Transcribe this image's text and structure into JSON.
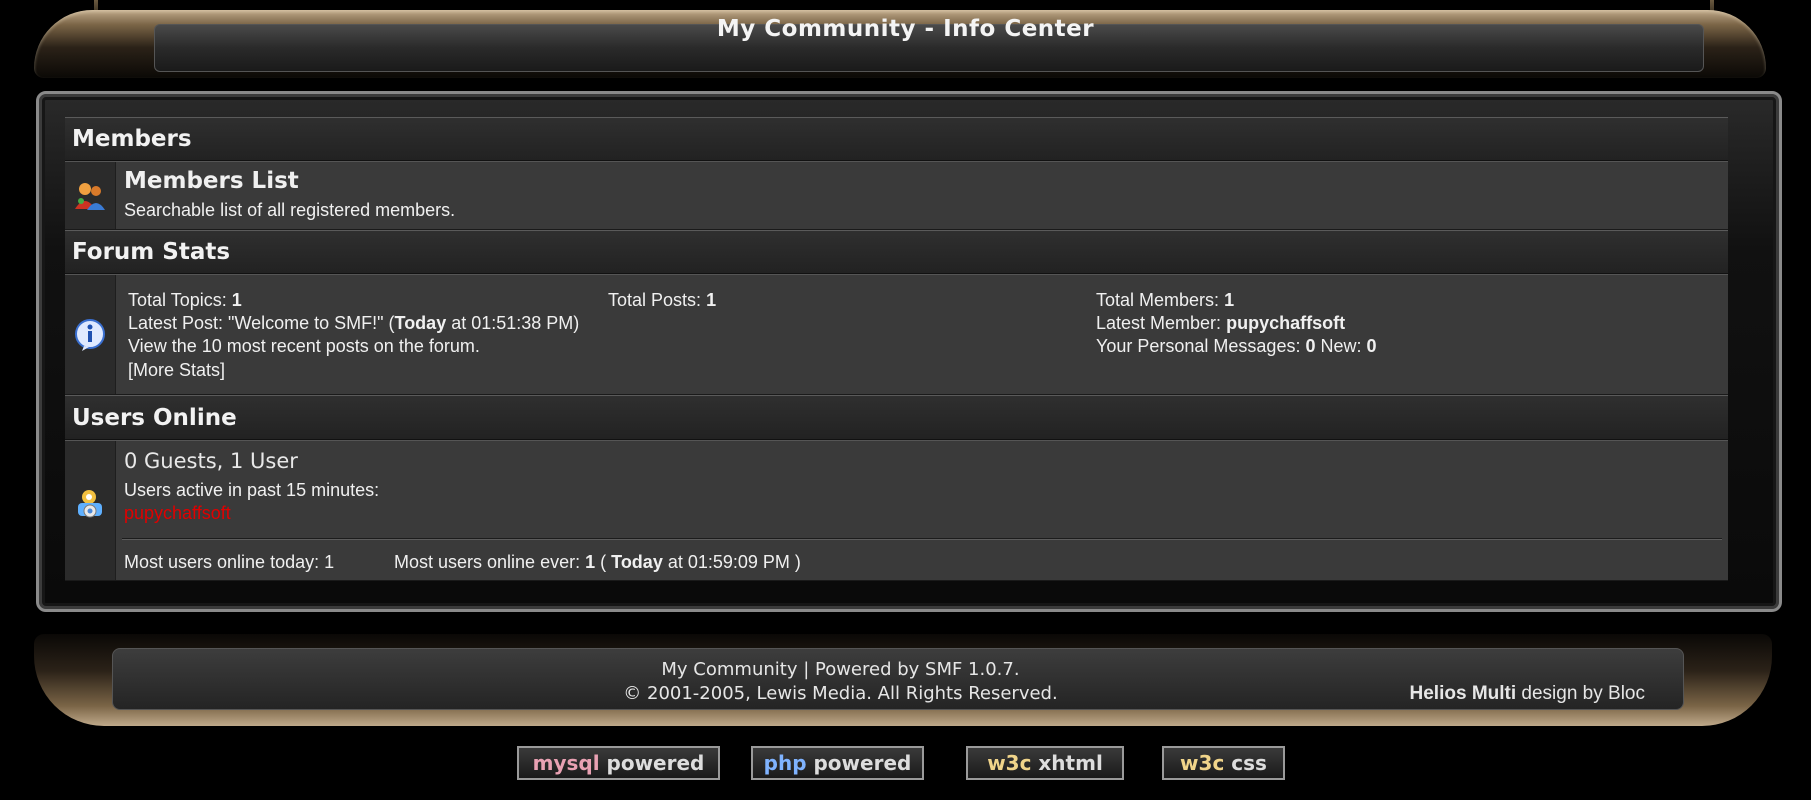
{
  "header": {
    "title": "My Community - Info Center"
  },
  "members": {
    "heading": "Members",
    "list_title": "Members List",
    "list_desc": "Searchable list of all registered members."
  },
  "stats": {
    "heading": "Forum Stats",
    "total_topics_label": "Total Topics:",
    "total_topics": "1",
    "total_posts_label": "Total Posts:",
    "total_posts": "1",
    "total_members_label": "Total Members:",
    "total_members": "1",
    "latest_post_label": "Latest Post: \"Welcome to SMF!\" (",
    "latest_post_today": "Today",
    "latest_post_time": " at 01:51:38 PM)",
    "latest_member_label": "Latest Member:",
    "latest_member": "pupychaffsoft",
    "recent_posts": "View the 10 most recent posts on the forum.",
    "pm_label": "Your Personal Messages:",
    "pm_count": "0",
    "pm_new_label": "New:",
    "pm_new": "0",
    "more_stats": "[More Stats]"
  },
  "online": {
    "heading": "Users Online",
    "summary": "0 Guests, 1 User",
    "active_label": "Users active in past 15 minutes:",
    "user": "pupychaffsoft",
    "today_label": "Most users online today: 1",
    "ever_label": "Most users online ever:",
    "ever_count": "1",
    "ever_open": "(",
    "ever_today": "Today",
    "ever_time": " at 01:59:09 PM )"
  },
  "footer": {
    "line1": "My Community | Powered by SMF 1.0.7.",
    "line2": "© 2001-2005, Lewis Media. All Rights Reserved.",
    "theme_name": "Helios Multi",
    "theme_by": " design by Bloc"
  },
  "badges": [
    {
      "a": "mysql",
      "b": " powered"
    },
    {
      "a": "php",
      "b": " powered"
    },
    {
      "a": "w3c",
      "b": " xhtml"
    },
    {
      "a": "w3c",
      "b": " css"
    }
  ]
}
